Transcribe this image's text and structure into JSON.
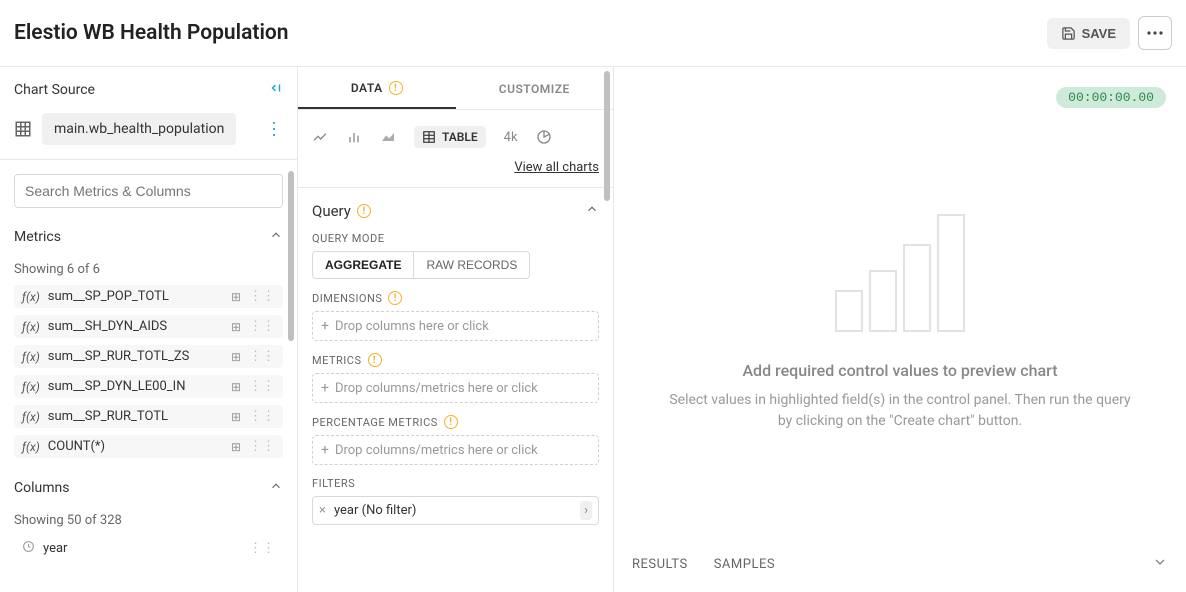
{
  "page_title": "Elestio WB Health Population",
  "save_label": "SAVE",
  "sidebar": {
    "heading": "Chart Source",
    "source": "main.wb_health_population",
    "search_placeholder": "Search Metrics & Columns",
    "metrics_label": "Metrics",
    "metrics_showing": "Showing 6 of 6",
    "metrics": [
      "sum__SP_POP_TOTL",
      "sum__SH_DYN_AIDS",
      "sum__SP_RUR_TOTL_ZS",
      "sum__SP_DYN_LE00_IN",
      "sum__SP_RUR_TOTL",
      "COUNT(*)"
    ],
    "columns_label": "Columns",
    "columns_showing": "Showing 50 of 328",
    "first_column": "year"
  },
  "tabs": {
    "data": "DATA",
    "customize": "CUSTOMIZE"
  },
  "viz": {
    "table": "TABLE",
    "fourk": "4k",
    "view_all": "View all charts"
  },
  "query": {
    "heading": "Query",
    "mode_label": "QUERY MODE",
    "mode_aggregate": "AGGREGATE",
    "mode_raw": "RAW RECORDS",
    "dimensions_label": "DIMENSIONS",
    "dimensions_placeholder": "Drop columns here or click",
    "metrics_label": "METRICS",
    "metrics_placeholder": "Drop columns/metrics here or click",
    "pct_label": "PERCENTAGE METRICS",
    "pct_placeholder": "Drop columns/metrics here or click",
    "filters_label": "FILTERS",
    "filter_chip": "year (No filter)"
  },
  "preview": {
    "timer": "00:00:00.00",
    "title": "Add required control values to preview chart",
    "subtitle": "Select values in highlighted field(s) in the control panel. Then run the query by clicking on the \"Create chart\" button.",
    "results_tab": "RESULTS",
    "samples_tab": "SAMPLES"
  }
}
